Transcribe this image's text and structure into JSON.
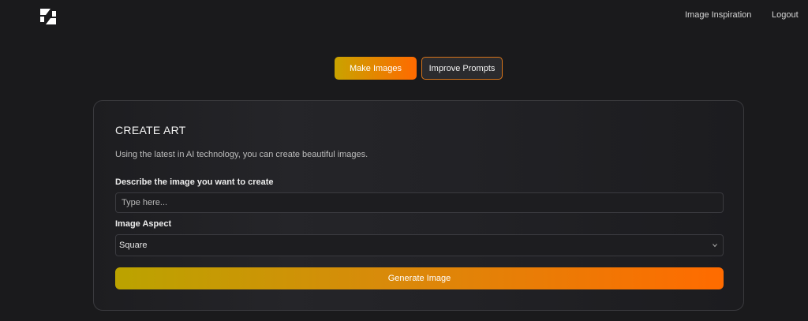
{
  "header": {
    "logo_icon": "brand-logo-icon",
    "nav": {
      "inspiration": "Image Inspiration",
      "logout": "Logout"
    }
  },
  "mode_tabs": {
    "make_images": "Make Images",
    "improve_prompts": "Improve Prompts",
    "active": "Make Images"
  },
  "create_art": {
    "title": "CREATE ART",
    "description": "Using the latest in AI technology, you can create beautiful images.",
    "prompt_label": "Describe the image you want to create",
    "prompt_placeholder": "Type here...",
    "prompt_value": "",
    "aspect_label": "Image Aspect",
    "aspect_selected": "Square",
    "aspect_icon": "chevron-down-icon",
    "generate_label": "Generate Image"
  },
  "colors": {
    "background": "#1a1a1c",
    "accent_start": "#c9a300",
    "accent_end": "#ff6a00",
    "tab_border": "#d8751a"
  }
}
